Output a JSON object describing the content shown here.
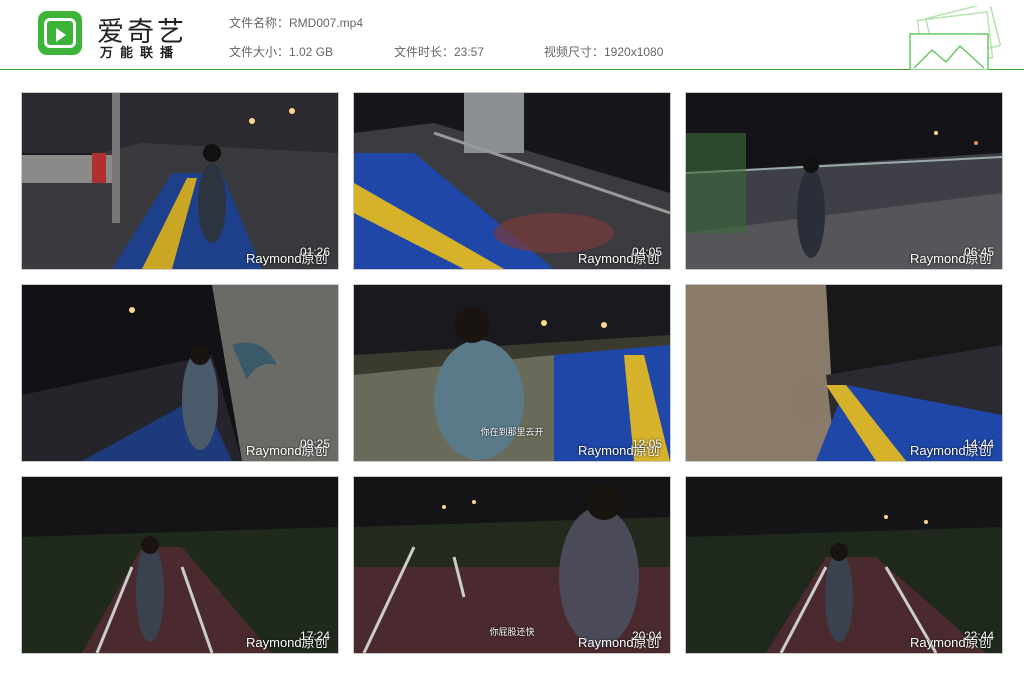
{
  "brand": {
    "title": "爱奇艺",
    "subtitle": "万能联播"
  },
  "info": {
    "file_name": "文件名称：RMD007.mp4",
    "file_size": "文件大小：1.02 GB",
    "duration": "文件时长：23:57",
    "resolution": "视频尺寸：1920x1080"
  },
  "colors": {
    "accent": "#3cb43a"
  },
  "thumbnails": [
    {
      "timestamp": "01:26",
      "watermark": "Raymond原创",
      "subtitle": ""
    },
    {
      "timestamp": "04:05",
      "watermark": "Raymond原创",
      "subtitle": ""
    },
    {
      "timestamp": "06:45",
      "watermark": "Raymond原创",
      "subtitle": ""
    },
    {
      "timestamp": "09:25",
      "watermark": "Raymond原创",
      "subtitle": ""
    },
    {
      "timestamp": "12:05",
      "watermark": "Raymond原创",
      "subtitle": "你在到那里去开"
    },
    {
      "timestamp": "14:44",
      "watermark": "Raymond原创",
      "subtitle": ""
    },
    {
      "timestamp": "17:24",
      "watermark": "Raymond原创",
      "subtitle": ""
    },
    {
      "timestamp": "20:04",
      "watermark": "Raymond原创",
      "subtitle": "你屁股还快"
    },
    {
      "timestamp": "22:44",
      "watermark": "Raymond原创",
      "subtitle": ""
    }
  ]
}
